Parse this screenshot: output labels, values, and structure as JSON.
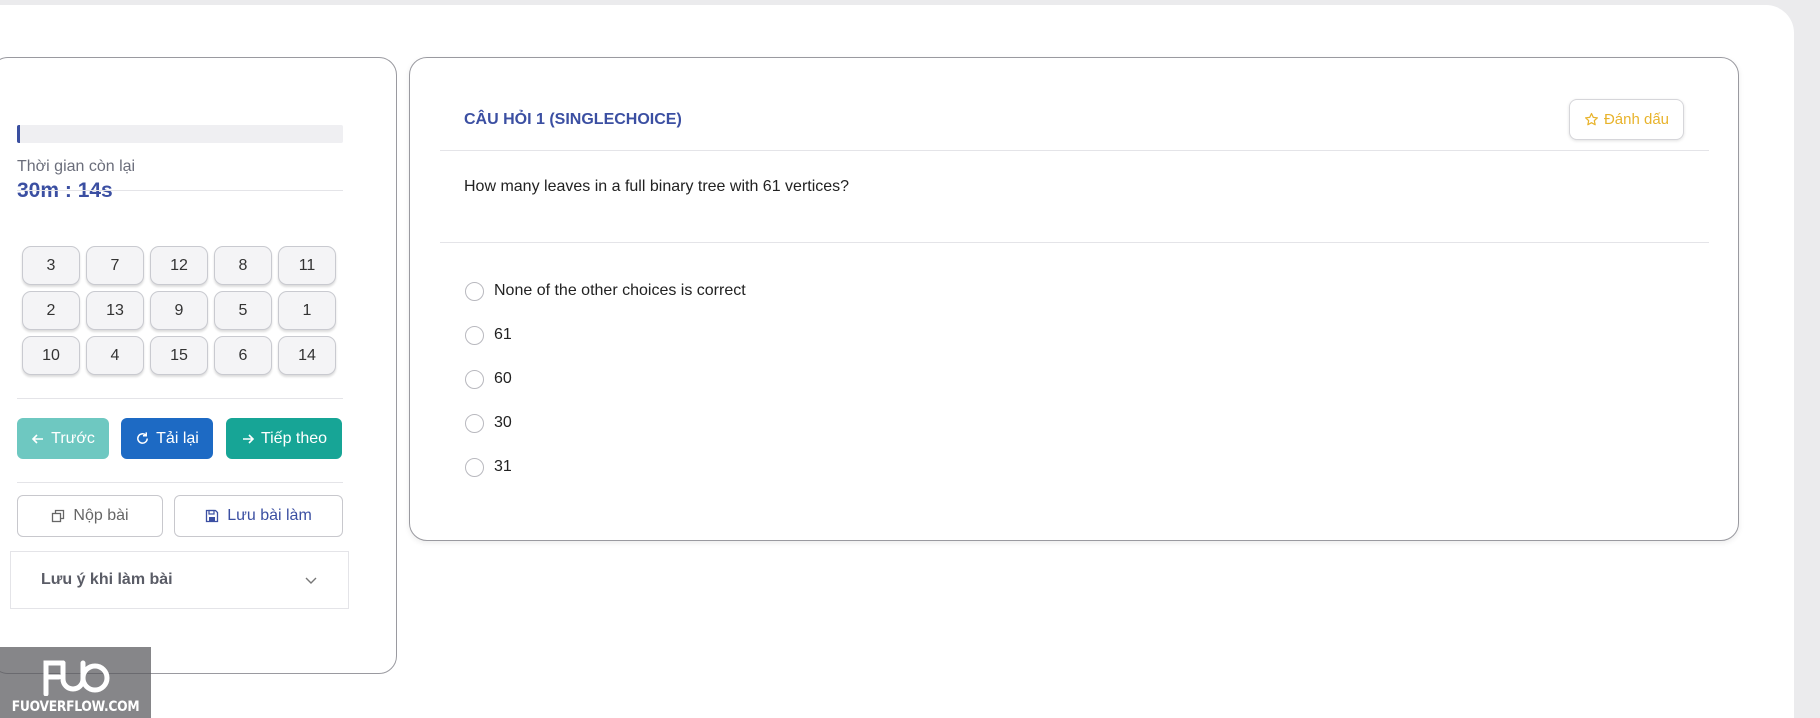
{
  "timer": {
    "label": "Thời gian còn lại",
    "value": "30m : 14s",
    "progress_fraction": 0.01
  },
  "question_grid": [
    [
      "3",
      "7",
      "12",
      "8",
      "11"
    ],
    [
      "2",
      "13",
      "9",
      "5",
      "1"
    ],
    [
      "10",
      "4",
      "15",
      "6",
      "14"
    ]
  ],
  "nav": {
    "prev_label": "Trước",
    "reload_label": "Tải lại",
    "next_label": "Tiếp theo"
  },
  "actions": {
    "submit_label": "Nộp bài",
    "save_label": "Lưu bài làm"
  },
  "notes": {
    "label": "Lưu ý khi làm bài"
  },
  "question": {
    "title": "CÂU HỎI 1 (SINGLECHOICE)",
    "mark_label": "Đánh dấu",
    "text": "How many leaves in a full binary tree with 61 vertices?",
    "options": [
      "None of the other choices is correct",
      "61",
      "60",
      "30",
      "31"
    ]
  },
  "watermark": {
    "text": "FUOVERFLOW.COM"
  },
  "colors": {
    "primary": "#3b4fa2",
    "prev": "#6ec8c1",
    "reload": "#1d6ac4",
    "next": "#17a596",
    "mark": "#e8b32b"
  }
}
